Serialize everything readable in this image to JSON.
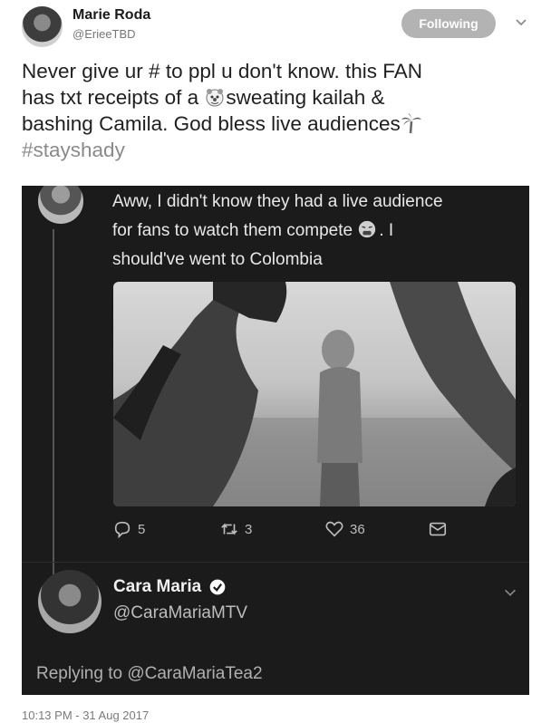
{
  "author": {
    "name": "Marie Roda",
    "handle": "@ErieeTBD",
    "follow_label": "Following"
  },
  "tweet": {
    "line1": "Never give ur # to ppl u don't know. this FAN",
    "line2a": "has txt receipts of a ",
    "line2b": "sweating kailah &",
    "line3": "bashing Camila. God bless live audiences",
    "hashtag": "#stayshady",
    "emojis": [
      "clown-face-icon",
      "palm-tree-icon"
    ]
  },
  "embedded": {
    "reply_line1": "Aww, I didn't know they had a live audience",
    "reply_line2a": "for fans to watch them compete ",
    "reply_line2b": ". I",
    "reply_line3": "should've went to Colombia",
    "reply_emoji": "weary-face-icon",
    "actions": {
      "replies": "5",
      "retweets": "3",
      "likes": "36"
    },
    "account": {
      "name": "Cara Maria",
      "handle": "@CaraMariaMTV",
      "verified": true
    },
    "replying_to": "Replying to @CaraMariaTea2"
  },
  "timestamp": "10:13 PM - 31 Aug 2017"
}
